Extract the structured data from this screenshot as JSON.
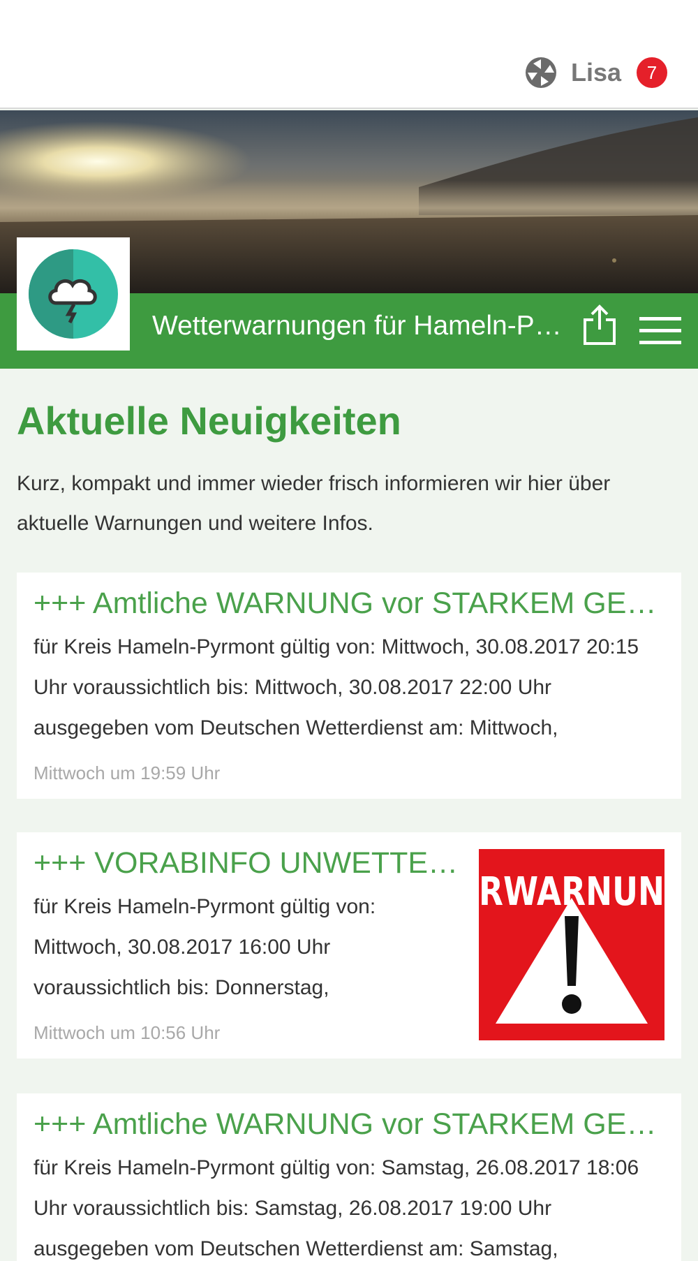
{
  "topbar": {
    "user_name": "Lisa",
    "notification_count": "7",
    "logo_icon": "community-logo-icon"
  },
  "header": {
    "title": "Wetterwarnungen für Hameln-Pyrmont",
    "avatar_icon": "storm-cloud-icon",
    "share_icon": "share-icon",
    "menu_icon": "hamburger-menu-icon",
    "bar_color": "#3e9b40"
  },
  "main": {
    "section_title": "Aktuelle Neuigkeiten",
    "section_intro": "Kurz, kompakt und immer wieder frisch informieren wir hier über aktuelle Warnungen und weitere Infos."
  },
  "posts": [
    {
      "title": "+++ Amtliche WARNUNG vor STARKEM GEWITTER +++",
      "excerpt": "für Kreis Hameln-Pyrmont gültig von: Mittwoch, 30.08.2017 20:15 Uhr voraussichtlich bis: Mittwoch, 30.08.2017 22:00 Uhr ausgegeben vom Deutschen Wetterdienst am: Mittwoch,",
      "time": "Mittwoch um 19:59 Uhr"
    },
    {
      "title": "+++ VORABINFO UNWETTER +++",
      "excerpt": "für Kreis Hameln-Pyrmont gültig von: Mittwoch, 30.08.2017 16:00 Uhr voraussichtlich bis: Donnerstag,",
      "time": "Mittwoch um 10:56 Uhr",
      "thumb_text": "RWARNUN"
    },
    {
      "title": "+++ Amtliche WARNUNG vor STARKEM GEWITTER +++",
      "excerpt": "für Kreis Hameln-Pyrmont gültig von: Samstag, 26.08.2017 18:06 Uhr voraussichtlich bis: Samstag, 26.08.2017 19:00 Uhr ausgegeben vom Deutschen Wetterdienst am: Samstag,"
    }
  ]
}
